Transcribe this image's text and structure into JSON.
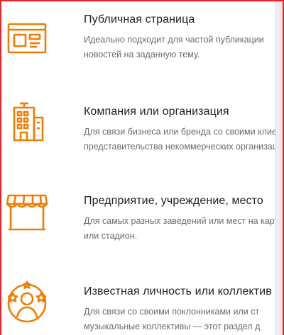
{
  "accent_color": "#ef7d00",
  "frame_color": "#e8232b",
  "page_types": [
    {
      "icon": "browser-window-icon",
      "title": "Публичная страница",
      "desc_line1": "Идеально подходит для частой публикации",
      "desc_line2": "новостей на заданную тему."
    },
    {
      "icon": "office-building-icon",
      "title": "Компания или организация",
      "desc_line1": "Для связи бизнеса или бренда со своими клиентами,",
      "desc_line2": "представительства некоммерческих организаций."
    },
    {
      "icon": "storefront-icon",
      "title": "Предприятие, учреждение, место",
      "desc_line1": "Для самых разных заведений или мест на карте",
      "desc_line2": "или стадион."
    },
    {
      "icon": "person-stars-icon",
      "title": "Известная личность или коллектив",
      "desc_line1": "Для связи со своими поклонниками или ст",
      "desc_line2": "музыкальные коллективы — этот раздел д"
    }
  ]
}
